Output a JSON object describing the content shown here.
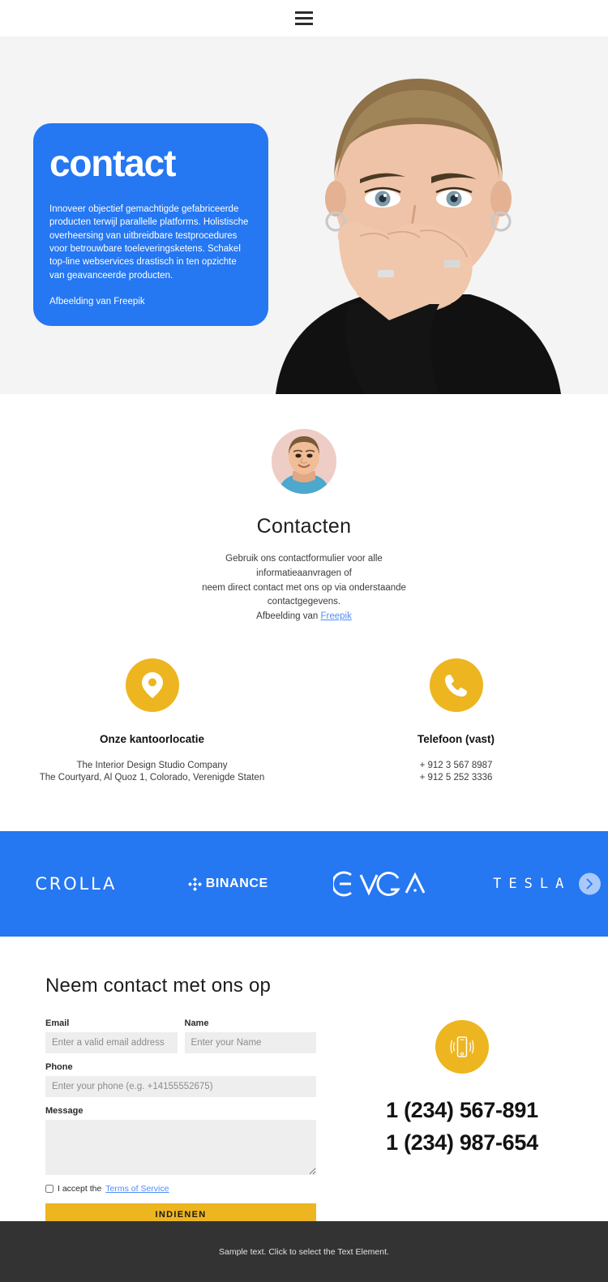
{
  "header": {
    "menu_icon": "hamburger-menu-icon"
  },
  "hero": {
    "title": "contact",
    "body": "Innoveer objectief gemachtigde gefabriceerde producten terwijl parallelle platforms. Holistische overheersing van uitbreidbare testprocedures voor betrouwbare toeleveringsketens. Schakel top-line webservices drastisch in ten opzichte van geavanceerde producten.",
    "credit": "Afbeelding van Freepik",
    "card_color": "#2577f2",
    "background_color": "#f4f4f4",
    "photo_alt": "woman-covering-mouth-photo"
  },
  "contacts": {
    "avatar_alt": "young-man-portrait-avatar",
    "title": "Contacten",
    "description_line1": "Gebruik ons contactformulier voor alle informatieaanvragen of",
    "description_line2": "neem direct contact met ons op via onderstaande",
    "description_line3": "contactgegevens.",
    "credit_prefix": "Afbeelding van ",
    "credit_link": "Freepik",
    "cards": [
      {
        "icon": "map-pin-icon",
        "heading": "Onze kantoorlocatie",
        "line1": "The Interior Design Studio Company",
        "line2": "The Courtyard, Al Quoz 1, Colorado, Verenigde Staten"
      },
      {
        "icon": "phone-icon",
        "heading": "Telefoon (vast)",
        "line1": "+ 912 3 567 8987",
        "line2": "+ 912 5 252 3336"
      }
    ]
  },
  "logos": {
    "background_color": "#2577f2",
    "items": [
      {
        "name": "CROLLA",
        "icon": "crolla-logo"
      },
      {
        "name": "BINANCE",
        "icon": "binance-logo"
      },
      {
        "name": "EVGA",
        "icon": "evga-logo"
      },
      {
        "name": "TESLA",
        "icon": "tesla-logo"
      }
    ],
    "next_icon": "chevron-right-icon"
  },
  "form": {
    "title": "Neem contact met ons op",
    "fields": {
      "email": {
        "label": "Email",
        "placeholder": "Enter a valid email address",
        "value": ""
      },
      "name": {
        "label": "Name",
        "placeholder": "Enter your Name",
        "value": ""
      },
      "phone": {
        "label": "Phone",
        "placeholder": "Enter your phone (e.g. +14155552675)",
        "value": ""
      },
      "message": {
        "label": "Message",
        "placeholder": "",
        "value": ""
      }
    },
    "accept_prefix": "I accept the ",
    "accept_link": "Terms of Service",
    "submit_label": "INDIENEN",
    "accent_color": "#edb520"
  },
  "side": {
    "icon": "mobile-phone-vibrate-icon",
    "phone1": "1 (234) 567-891",
    "phone2": "1 (234) 987-654"
  },
  "footer": {
    "text": "Sample text. Click to select the Text Element.",
    "background_color": "#333333"
  }
}
